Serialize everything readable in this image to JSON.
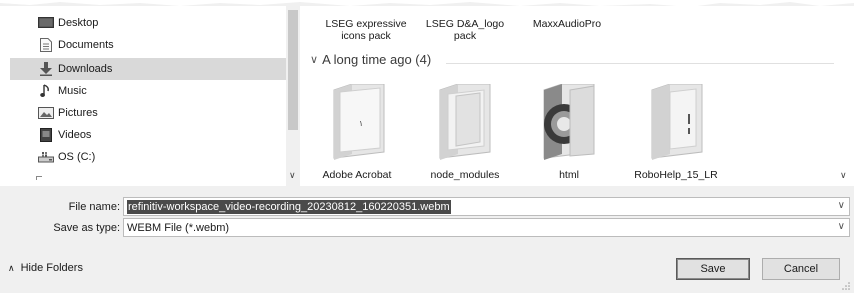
{
  "nav": {
    "items": [
      {
        "label": "Desktop",
        "icon": "desktop-icon"
      },
      {
        "label": "Documents",
        "icon": "documents-icon"
      },
      {
        "label": "Downloads",
        "icon": "downloads-icon",
        "selected": true
      },
      {
        "label": "Music",
        "icon": "music-icon"
      },
      {
        "label": "Pictures",
        "icon": "pictures-icon"
      },
      {
        "label": "Videos",
        "icon": "videos-icon"
      },
      {
        "label": "OS (C:)",
        "icon": "drive-icon"
      }
    ]
  },
  "files": {
    "top_row": [
      {
        "label": "LSEG expressive icons pack"
      },
      {
        "label": "LSEG D&A_logo pack"
      },
      {
        "label": "MaxxAudioPro"
      }
    ],
    "group": {
      "label": "A long time ago (4)"
    },
    "items": [
      {
        "label": "Adobe Acrobat",
        "icon": "folder-icon"
      },
      {
        "label": "node_modules",
        "icon": "folder-icon"
      },
      {
        "label": "html",
        "icon": "folder-icon"
      },
      {
        "label": "RoboHelp_15_LR",
        "icon": "folder-icon"
      }
    ]
  },
  "form": {
    "file_name_label": "File name:",
    "file_name_value": "refinitiv-workspace_video-recording_20230812_160220351.webm",
    "save_type_label": "Save as type:",
    "save_type_value": "WEBM File (*.webm)"
  },
  "footer": {
    "hide_folders": "Hide Folders",
    "save": "Save",
    "cancel": "Cancel"
  }
}
